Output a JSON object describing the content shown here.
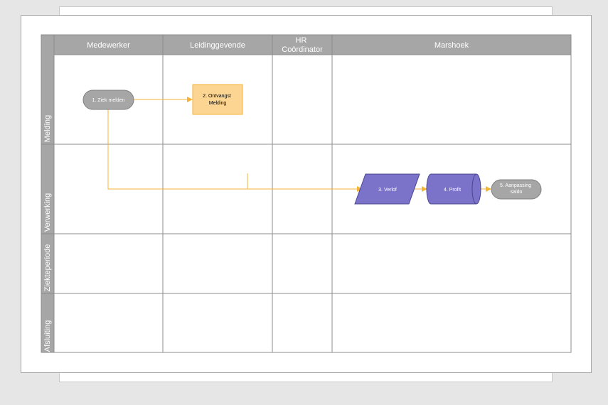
{
  "lanes": [
    {
      "id": "medewerker",
      "lines": [
        "Medewerker"
      ]
    },
    {
      "id": "leidinggevende",
      "lines": [
        "Leidinggevende"
      ]
    },
    {
      "id": "hr-coordinator",
      "lines": [
        "HR",
        "Coördinator"
      ]
    },
    {
      "id": "marshoek",
      "lines": [
        "Marshoek"
      ]
    }
  ],
  "phases": [
    "Melding",
    "Verwerking",
    "Ziekteperiode",
    "Afsluiting"
  ],
  "nodes": [
    {
      "id": "ziek-melden",
      "shape": "terminator",
      "lines": [
        "1. Ziek melden"
      ]
    },
    {
      "id": "ontvangst-melding",
      "shape": "process",
      "lines": [
        "2. Ontvangst",
        "Melding"
      ]
    },
    {
      "id": "verlof",
      "shape": "data",
      "lines": [
        "3. Verlof"
      ]
    },
    {
      "id": "profit",
      "shape": "database",
      "lines": [
        "4. Profit"
      ]
    },
    {
      "id": "aanpassing-saldo",
      "shape": "terminator",
      "lines": [
        "5. Aanpassing",
        "saldo"
      ]
    }
  ],
  "colors": {
    "header_fill": "#a6a6a6",
    "grid_line": "#8c8c8c",
    "connector": "#f5b335",
    "terminator_fill": "#a6a6a6",
    "process_fill": "#fcd593",
    "process_stroke": "#f5b335",
    "data_fill": "#7b72c9",
    "data_stroke": "#4b4690"
  }
}
